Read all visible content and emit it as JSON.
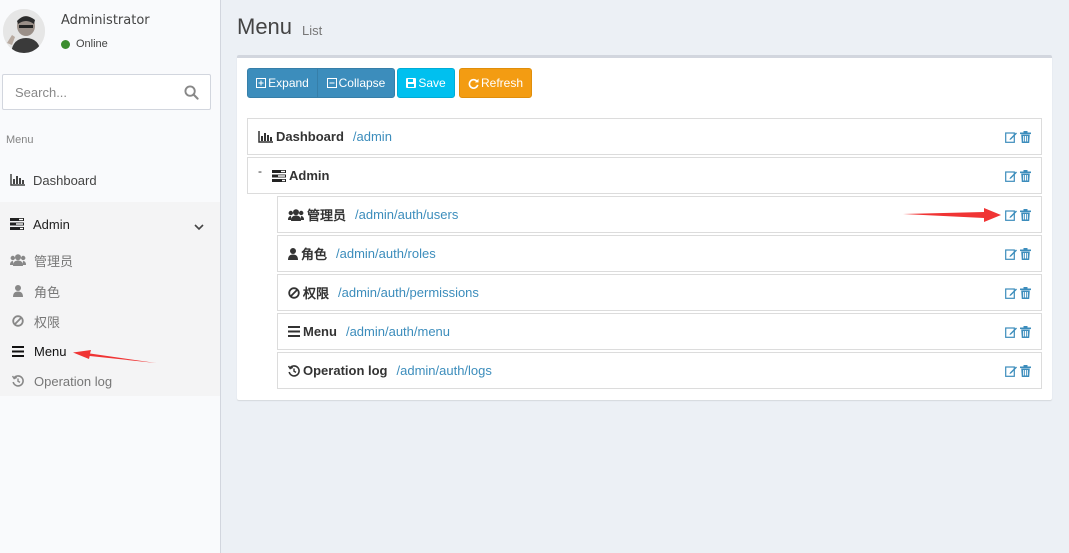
{
  "user": {
    "name": "Administrator",
    "status": "Online"
  },
  "search": {
    "placeholder": "Search..."
  },
  "sidebar": {
    "header": "Menu",
    "dashboard": "Dashboard",
    "admin": "Admin",
    "items": [
      {
        "label": "管理员",
        "icon": "users-icon"
      },
      {
        "label": "角色",
        "icon": "user-icon"
      },
      {
        "label": "权限",
        "icon": "ban-icon"
      },
      {
        "label": "Menu",
        "icon": "bars-icon"
      },
      {
        "label": "Operation log",
        "icon": "history-icon"
      }
    ]
  },
  "page": {
    "title": "Menu",
    "subtitle": "List"
  },
  "toolbar": {
    "expand": "Expand",
    "collapse": "Collapse",
    "save": "Save",
    "refresh": "Refresh"
  },
  "tree": {
    "toggle": "-",
    "rows": [
      {
        "title": "Dashboard",
        "uri": "/admin",
        "icon": "bar-chart-icon"
      },
      {
        "title": "Admin",
        "uri": "",
        "icon": "tasks-icon"
      },
      {
        "title": "管理员",
        "uri": "/admin/auth/users",
        "icon": "users-icon"
      },
      {
        "title": "角色",
        "uri": "/admin/auth/roles",
        "icon": "user-icon"
      },
      {
        "title": "权限",
        "uri": "/admin/auth/permissions",
        "icon": "ban-icon"
      },
      {
        "title": "Menu",
        "uri": "/admin/auth/menu",
        "icon": "bars-icon"
      },
      {
        "title": "Operation log",
        "uri": "/admin/auth/logs",
        "icon": "history-icon"
      }
    ]
  },
  "colors": {
    "primary": "#3c8dbc",
    "info": "#00c0ef",
    "warning": "#f39c12",
    "online": "#3c8d2f",
    "arrow": "#f03434"
  }
}
